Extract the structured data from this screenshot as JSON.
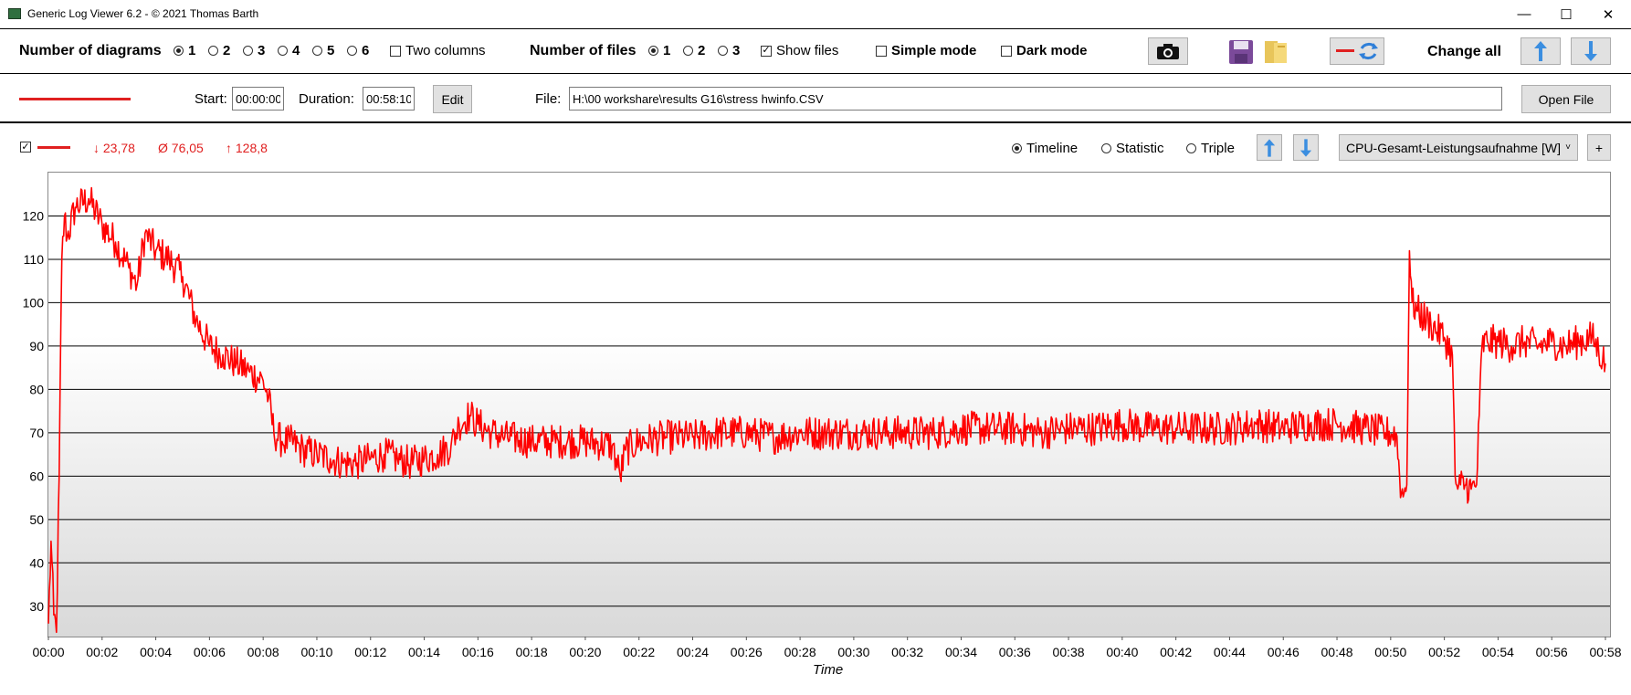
{
  "window": {
    "title": "Generic Log Viewer 6.2 - © 2021 Thomas Barth",
    "minimize_glyph": "—",
    "maximize_glyph": "☐",
    "close_glyph": "✕"
  },
  "toolbar": {
    "diagrams_label": "Number of diagrams",
    "diagram_options": [
      "1",
      "2",
      "3",
      "4",
      "5",
      "6"
    ],
    "diagram_selected": "1",
    "two_columns_label": "Two columns",
    "files_label": "Number of files",
    "file_options": [
      "1",
      "2",
      "3"
    ],
    "file_selected": "1",
    "show_files_label": "Show files",
    "show_files_checked": true,
    "simple_mode_label": "Simple mode",
    "dark_mode_label": "Dark mode",
    "change_all_label": "Change all",
    "icons": [
      "camera-icon",
      "save-icon",
      "folder-icon",
      "line-refresh-icon",
      "arrow-up-icon",
      "arrow-down-icon"
    ]
  },
  "file_row": {
    "start_label": "Start:",
    "start_value": "00:00:00",
    "duration_label": "Duration:",
    "duration_value": "00:58:10",
    "edit_label": "Edit",
    "file_label": "File:",
    "file_path": "H:\\00 workshare\\results G16\\stress hwinfo.CSV",
    "open_file_label": "Open File",
    "line_color": "#e02020"
  },
  "diagram": {
    "stat_min": "↓ 23,78",
    "stat_avg": "Ø 76,05",
    "stat_max": "↑ 128,8",
    "mode_options": [
      "Timeline",
      "Statistic",
      "Triple"
    ],
    "mode_selected": "Timeline",
    "channel": "CPU-Gesamt-Leistungsaufnahme [W]",
    "add_label": "+",
    "x_axis_label": "Time"
  },
  "chart_data": {
    "type": "line",
    "title": "",
    "xlabel": "Time",
    "ylabel": "",
    "ylim": [
      23,
      130
    ],
    "y_ticks": [
      "30",
      "40",
      "50",
      "60",
      "70",
      "80",
      "90",
      "100",
      "110",
      "120"
    ],
    "x_ticks": [
      "00:00",
      "00:02",
      "00:04",
      "00:06",
      "00:08",
      "00:10",
      "00:12",
      "00:14",
      "00:16",
      "00:18",
      "00:20",
      "00:22",
      "00:24",
      "00:26",
      "00:28",
      "00:30",
      "00:32",
      "00:34",
      "00:36",
      "00:38",
      "00:40",
      "00:42",
      "00:44",
      "00:46",
      "00:48",
      "00:50",
      "00:52",
      "00:54",
      "00:56",
      "00:58"
    ],
    "xlim_minutes": [
      0,
      58.17
    ],
    "series": [
      {
        "color": "#ff0000",
        "x_minutes": [
          0.0,
          0.1,
          0.2,
          0.3,
          0.4,
          0.5,
          0.6,
          0.7,
          1.0,
          1.5,
          2.0,
          2.5,
          3.0,
          3.3,
          3.6,
          4.0,
          4.5,
          5.0,
          5.5,
          6.0,
          6.5,
          7.0,
          7.5,
          8.0,
          8.2,
          8.4,
          8.7,
          9.0,
          9.5,
          10.0,
          10.5,
          11.0,
          11.5,
          12.0,
          12.5,
          13.0,
          13.5,
          14.0,
          14.5,
          15.0,
          15.3,
          15.7,
          16.0,
          16.5,
          17.0,
          18.0,
          19.0,
          20.0,
          21.0,
          21.3,
          21.5,
          22.0,
          23.0,
          24.0,
          25.0,
          26.0,
          27.0,
          28.0,
          29.0,
          30.0,
          31.0,
          32.0,
          33.0,
          34.0,
          35.0,
          36.0,
          37.0,
          38.0,
          39.0,
          40.0,
          41.0,
          42.0,
          43.0,
          44.0,
          45.0,
          46.0,
          47.0,
          48.0,
          49.0,
          49.8,
          50.2,
          50.4,
          50.5,
          50.6,
          50.7,
          50.8,
          51.0,
          51.5,
          52.0,
          52.3,
          52.4,
          52.5,
          52.6,
          52.8,
          53.0,
          53.2,
          53.3,
          53.4,
          53.6,
          54.0,
          54.5,
          55.0,
          55.5,
          56.0,
          56.5,
          57.0,
          57.5,
          58.0
        ],
        "values": [
          26,
          45,
          28,
          24,
          60,
          110,
          120,
          115,
          122,
          124,
          118,
          114,
          108,
          104,
          116,
          112,
          110,
          106,
          96,
          90,
          88,
          86,
          84,
          82,
          78,
          70,
          68,
          68,
          66,
          65,
          64,
          63,
          63,
          64,
          65,
          64,
          63,
          64,
          65,
          67,
          72,
          74,
          72,
          70,
          69,
          68,
          68,
          68,
          67,
          60,
          66,
          68,
          69,
          69,
          70,
          70,
          69,
          70,
          70,
          70,
          70,
          70,
          70,
          71,
          71,
          71,
          70,
          71,
          71,
          72,
          71,
          71,
          71,
          71,
          72,
          71,
          72,
          72,
          71,
          70,
          70,
          56,
          56,
          58,
          112,
          100,
          98,
          95,
          92,
          88,
          60,
          57,
          58,
          58,
          57,
          58,
          74,
          90,
          91,
          91,
          90,
          91,
          90,
          91,
          90,
          91,
          92,
          86
        ]
      }
    ]
  }
}
